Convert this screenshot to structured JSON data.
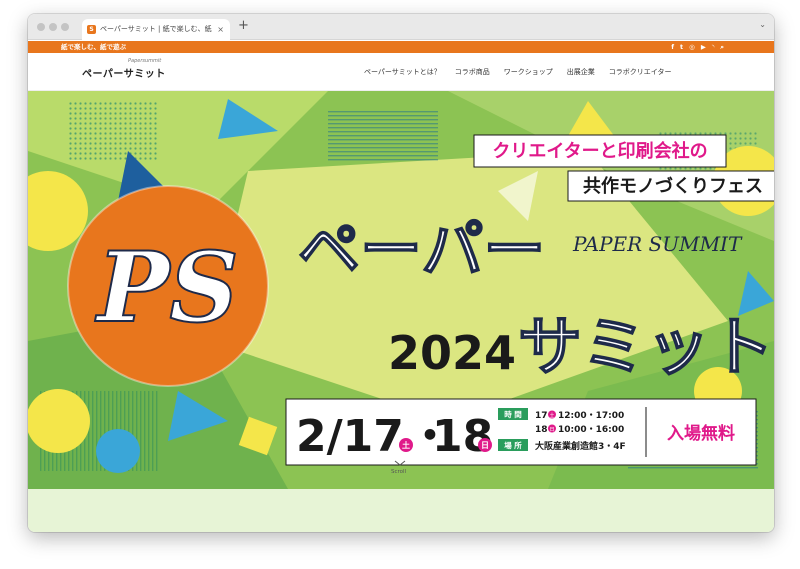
{
  "browser": {
    "tab_title": "ペーパーサミット | 紙で楽しむ、紙",
    "tab_close": "×",
    "new_tab": "+",
    "chevron": "⌄",
    "favicon_letter": "S"
  },
  "topbar": {
    "tagline": "紙で楽しむ、紙で遊ぶ",
    "social_icons": [
      "f",
      "t",
      "◎",
      "▶",
      "◝",
      "⌕"
    ],
    "social_names": [
      "facebook-icon",
      "twitter-icon",
      "instagram-icon",
      "youtube-icon",
      "rss-icon",
      "search-icon"
    ],
    "accent": "#e8761d"
  },
  "nav": {
    "logo": "ペーパーサミット",
    "logo_sub": "Papersummit",
    "items": [
      "ペーパーサミットとは？",
      "コラボ商品",
      "ワークショップ",
      "出展企業",
      "コラボクリエイター"
    ]
  },
  "hero": {
    "catch_line1": "クリエイターと印刷会社の",
    "catch_line2": "共作モノづくりフェス",
    "ps_logo": "PS",
    "title_line1": "ペーパー",
    "title_en": "PAPER SUMMIT",
    "year": "2024",
    "title_line2": "サミット",
    "date": {
      "month_day1": "2/17",
      "dot": "・",
      "day2": "18",
      "sat": "土",
      "sun": "日"
    },
    "time_label": "時 間",
    "time_row1_day": "17",
    "time_row1_dow": "土",
    "time_row1": "12:00・17:00",
    "time_row2_day": "18",
    "time_row2_dow": "日",
    "time_row2": "10:00・16:00",
    "place_label": "場 所",
    "place": "大阪産業創造館3・4F",
    "admission": "入場無料",
    "scroll": "Scroll",
    "colors": {
      "green": "#8fc456",
      "yellow": "#f4e64a",
      "pink": "#e0198a",
      "orange": "#e8761d",
      "navy": "#1e2a4a"
    }
  }
}
